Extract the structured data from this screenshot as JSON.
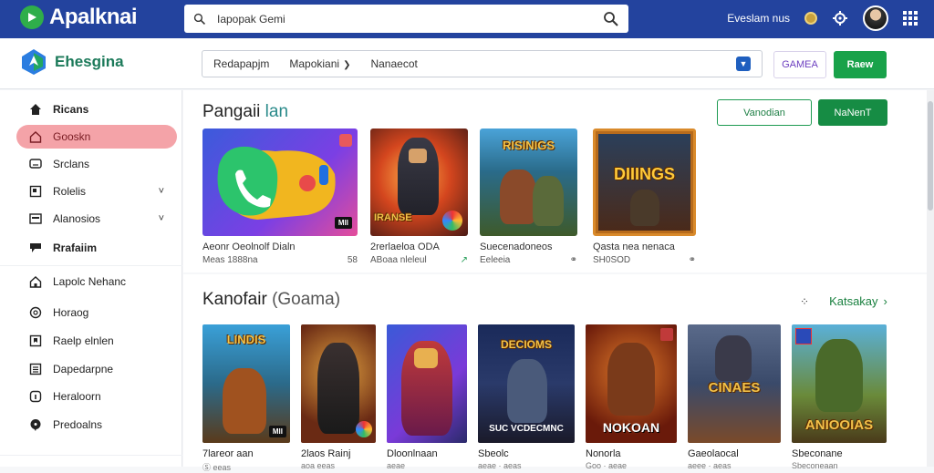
{
  "topbar": {
    "brand": "Apalknai",
    "search_value": "Iapopak Gemi",
    "right_link": "Eveslam nus"
  },
  "subbar": {
    "brand": "Ehesgina",
    "filters": [
      "Redapapjm",
      "Mapokiani",
      "Nanaecot"
    ],
    "game_button": "GAMEA",
    "new_button": "Raew"
  },
  "sidebar": {
    "items": [
      {
        "label": "Ricans",
        "icon": "home-icon"
      },
      {
        "label": "Gooskn",
        "icon": "house-outline-icon"
      },
      {
        "label": "Srclans",
        "icon": "screen-icon"
      },
      {
        "label": "Rolelis",
        "icon": "box-icon",
        "chevron": "˅"
      },
      {
        "label": "Alanosios",
        "icon": "keyboard-icon",
        "chevron": "˅"
      },
      {
        "label": "Rrafaiim",
        "icon": "flag-icon"
      },
      {
        "label": "Lapolc Nehanc",
        "icon": "home-outline-icon"
      },
      {
        "label": "Horaog",
        "icon": "circle-icon"
      },
      {
        "label": "Raelp elnlen",
        "icon": "bookmark-icon"
      },
      {
        "label": "Dapedarpne",
        "icon": "list-icon"
      },
      {
        "label": "Heraloorn",
        "icon": "info-icon"
      },
      {
        "label": "Predoalns",
        "icon": "chat-icon"
      }
    ]
  },
  "section1": {
    "title": "Pangaii",
    "subtitle": "lan",
    "outline_button": "Vanodian",
    "solid_button": "NaNenT",
    "cards": [
      {
        "name": "Aeonr Oeolnolf Dialn",
        "meta": "Meas 1888na",
        "meta_right": "58",
        "badge": "MII"
      },
      {
        "name": "2rerlaeloa ODA",
        "meta": "ABoaa nleleul",
        "meta_right": "↗",
        "art": "IRANSE"
      },
      {
        "name": "Suecenadoneos",
        "meta": "Eeleeia",
        "meta_right": "⚭",
        "art": "RISINIGS"
      },
      {
        "name": "Qasta nea nenaca",
        "meta": "SH0SOD",
        "meta_right": "⚭",
        "art": "DIIINGS"
      }
    ]
  },
  "section2": {
    "title": "Kanofair",
    "subtitle": "(Goama)",
    "more_link": "Katsakay",
    "cards": [
      {
        "name": "7lareor aan",
        "meta": "Ⓢ eeas",
        "art": "LINDIS"
      },
      {
        "name": "2laos Rainj",
        "meta": "aoa eeas"
      },
      {
        "name": "Dloonlnaan",
        "meta": "aeae"
      },
      {
        "name": "Sbeolc",
        "meta": "aeae · aeas",
        "art": "SUC VCDECMNC"
      },
      {
        "name": "Nonorla",
        "meta": "Goo · aeae",
        "art": "NOKOAN"
      },
      {
        "name": "Gaeolaocal",
        "meta": "aeee · aeas",
        "art": "CINAES"
      },
      {
        "name": "Sbeconane",
        "meta": "Sbeconeaan",
        "art": "ANIOOIAS"
      }
    ]
  }
}
